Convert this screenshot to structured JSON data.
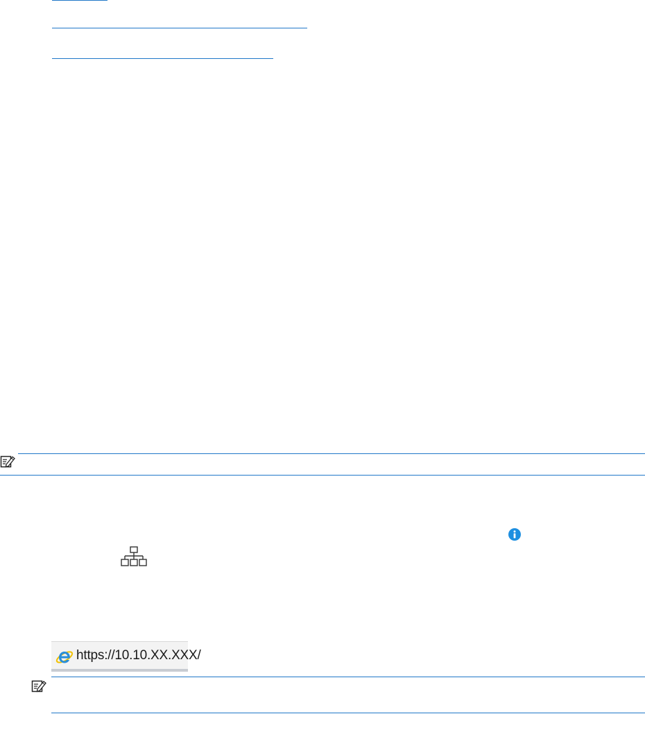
{
  "address_bar": {
    "url": "https://10.10.XX.XXX/"
  },
  "icons": {
    "note": "note-pencil-icon",
    "info": "info-icon",
    "network": "network-icon",
    "browser": "internet-explorer-icon"
  },
  "colors": {
    "link": "#1f77c8",
    "info": "#1e8fe0",
    "rule": "#1f77c8"
  }
}
